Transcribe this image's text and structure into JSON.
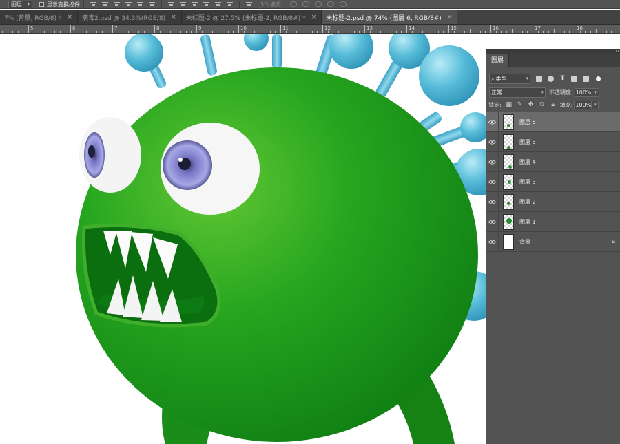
{
  "options_bar": {
    "layer_select_value": "图层",
    "show_transform_label": "显示变换控件",
    "mode_3d_label": "3D 模式:"
  },
  "tabs": [
    {
      "label": "7% (背景, RGB/8) *",
      "active": false
    },
    {
      "label": "病毒2.psd @ 34.3%(RGB/8)",
      "active": false
    },
    {
      "label": "未标题-2 @ 27.5% (未标题-2, RGB/8#) *",
      "active": false
    },
    {
      "label": "未标题-2.psd @ 74% (图层 6, RGB/8#)",
      "active": true
    }
  ],
  "tab_close_glyph": "×",
  "ruler": {
    "labels": [
      "4",
      "5",
      "6",
      "7",
      "8",
      "9",
      "10",
      "11",
      "12",
      "13",
      "14",
      "15",
      "16",
      "17",
      "18"
    ]
  },
  "panel": {
    "title": "图层",
    "collapse_glyph": "‹‹",
    "filter_kind": "类型",
    "blend_mode": "正常",
    "opacity_label": "不透明度:",
    "opacity_value": "100%",
    "lock_label": "锁定:",
    "fill_label": "填充:",
    "fill_value": "100%"
  },
  "layers": [
    {
      "name": "图层 6",
      "selected": true,
      "locked": false,
      "thumb": "content"
    },
    {
      "name": "图层 5",
      "selected": false,
      "locked": false,
      "thumb": "content"
    },
    {
      "name": "图层 4",
      "selected": false,
      "locked": false,
      "thumb": "content"
    },
    {
      "name": "图层 3",
      "selected": false,
      "locked": false,
      "thumb": "content"
    },
    {
      "name": "图层 2",
      "selected": false,
      "locked": false,
      "thumb": "content"
    },
    {
      "name": "图层 1",
      "selected": false,
      "locked": false,
      "thumb": "content"
    },
    {
      "name": "背景",
      "selected": false,
      "locked": true,
      "thumb": "white"
    }
  ],
  "colors": {
    "virus_green": "#1f9b1c",
    "spike_blue": "#4fb7d6",
    "ui_dark": "#535353"
  }
}
